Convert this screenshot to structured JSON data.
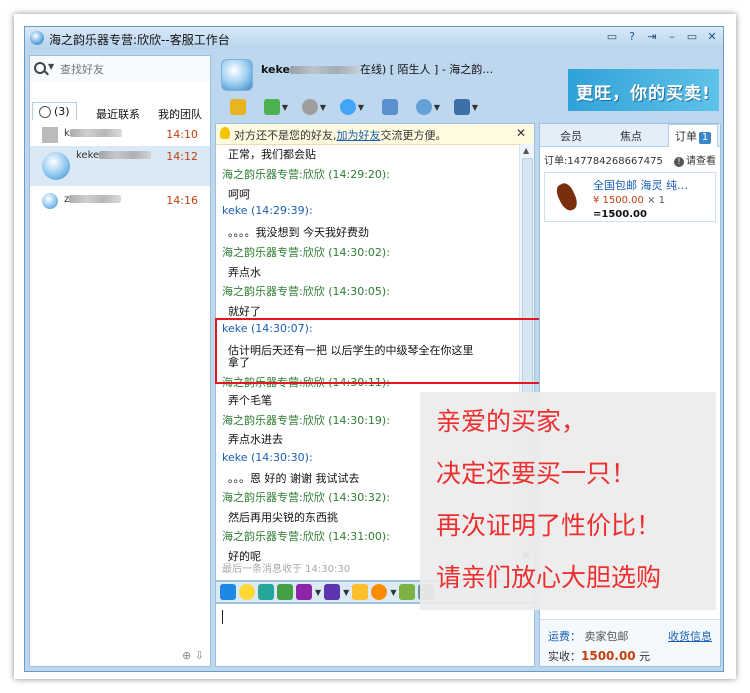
{
  "window": {
    "title": "海之韵乐器专营:欣欣--客服工作台",
    "buttons": [
      "▭",
      "?",
      "⇥",
      "–",
      "▭",
      "✕"
    ]
  },
  "sidebar": {
    "search_placeholder": "查找好友",
    "tabs": [
      "(3)",
      "最近联系",
      "我的团队"
    ],
    "contacts": [
      {
        "name": "k",
        "time": "14:10"
      },
      {
        "name": "keke",
        "time": "14:12"
      },
      {
        "name": "z",
        "time": "14:16"
      }
    ]
  },
  "chat": {
    "header": "keke",
    "header_rest": "在线) [ 陌生人 ] - 海之韵…",
    "notice": {
      "prefix": "对方还不是您的好友,",
      "link": "加为好友",
      "suffix": "交流更方便。"
    },
    "messages": [
      {
        "type": "body",
        "text": "正常，我们都会贴"
      },
      {
        "type": "seller",
        "text": "海之韵乐器专营:欣欣 (14:29:20):"
      },
      {
        "type": "body",
        "text": "呵呵"
      },
      {
        "type": "buyer",
        "text": "keke (14:29:39):"
      },
      {
        "type": "body",
        "text": "。。。。我没想到  今天我好费劲"
      },
      {
        "type": "seller",
        "text": "海之韵乐器专营:欣欣 (14:30:02):"
      },
      {
        "type": "body",
        "text": "弄点水"
      },
      {
        "type": "seller",
        "text": "海之韵乐器专营:欣欣 (14:30:05):"
      },
      {
        "type": "body",
        "text": "就好了"
      },
      {
        "type": "buyer",
        "text": "keke (14:30:07):"
      },
      {
        "type": "body",
        "text": "估计明后天还有一把   以后学生的中级琴全在你这里"
      },
      {
        "type": "body",
        "text": "拿了"
      },
      {
        "type": "seller",
        "text": "海之韵乐器专营:欣欣 (14:30:11):"
      },
      {
        "type": "body",
        "text": "弄个毛笔"
      },
      {
        "type": "seller",
        "text": "海之韵乐器专营:欣欣 (14:30:19):"
      },
      {
        "type": "body",
        "text": "弄点水进去"
      },
      {
        "type": "buyer",
        "text": "keke (14:30:30):"
      },
      {
        "type": "body",
        "text": "。。。恩   好的   谢谢   我试试去"
      },
      {
        "type": "seller",
        "text": "海之韵乐器专营:欣欣 (14:30:32):"
      },
      {
        "type": "body",
        "text": "然后再用尖锐的东西挑"
      },
      {
        "type": "seller",
        "text": "海之韵乐器专营:欣欣 (14:31:00):"
      },
      {
        "type": "body",
        "text": "好的呢"
      }
    ],
    "last_msg": "最后一条消息收于 14:30:30"
  },
  "banner": {
    "text": "更旺，你的买卖!"
  },
  "right": {
    "tabs": [
      "会员",
      "焦点",
      "订单"
    ],
    "order_badge": "1",
    "order_no": "订单:147784268667475",
    "help": "请查看",
    "product": {
      "name": "全国包邮 海灵 纯…",
      "price": "¥ 1500.00",
      "qty": "× 1",
      "total": "=1500.00"
    },
    "shipping_label": "运费：",
    "shipping_value": "卖家包邮",
    "receipt_link": "收货信息",
    "paid_label": "实收：",
    "paid_value": "1500.00",
    "paid_unit": "元"
  },
  "caption": [
    "亲爱的买家，",
    "决定还要买一只！",
    "再次证明了性价比！",
    "请亲们放心大胆选购"
  ]
}
